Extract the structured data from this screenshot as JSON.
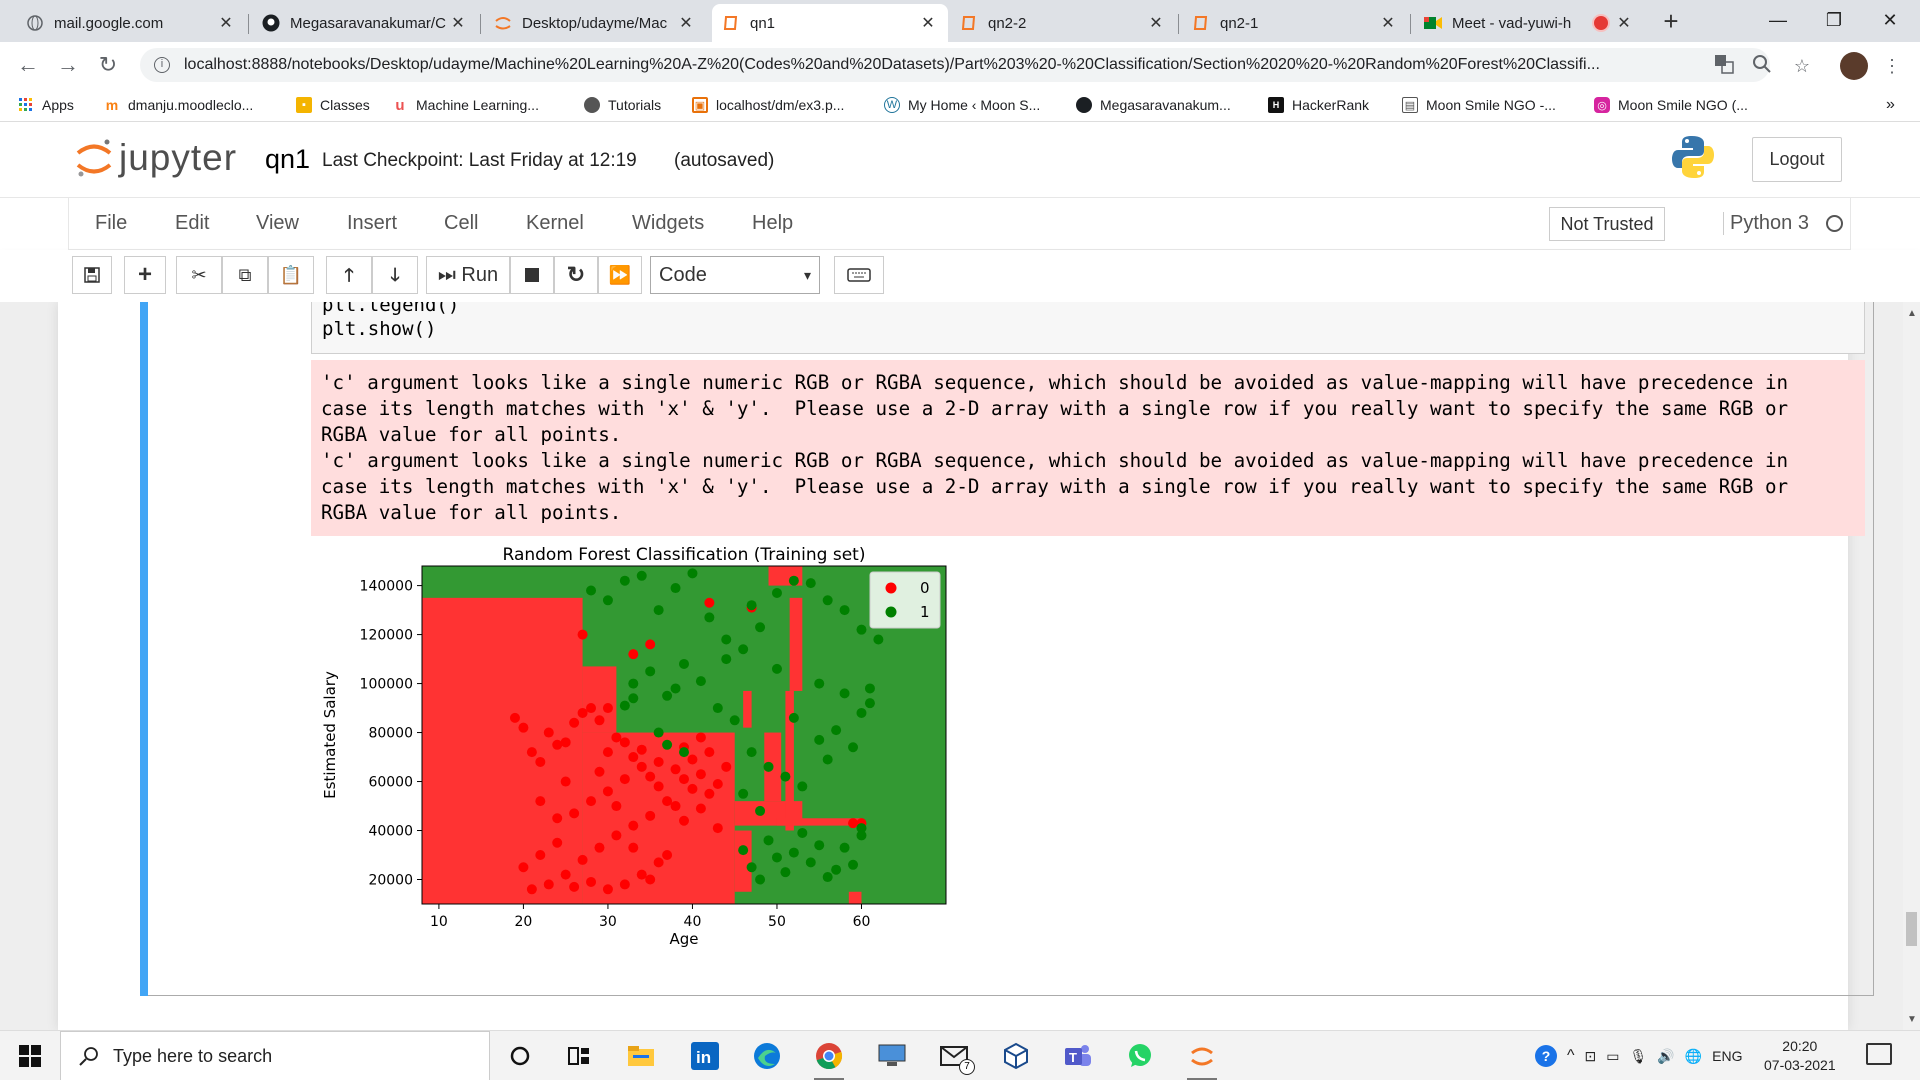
{
  "browser": {
    "tabs": [
      {
        "title": "mail.google.com",
        "icon": "globe-icon"
      },
      {
        "title": "Megasaravanakumar/C",
        "icon": "github-icon"
      },
      {
        "title": "Desktop/udayme/Mac",
        "icon": "jupyter-icon"
      },
      {
        "title": "qn1",
        "icon": "notebook-icon",
        "active": true
      },
      {
        "title": "qn2-2",
        "icon": "notebook-icon"
      },
      {
        "title": "qn2-1",
        "icon": "notebook-icon"
      },
      {
        "title": "Meet - vad-yuwi-h",
        "icon": "meet-icon",
        "recording": true
      }
    ],
    "new_tab": "+",
    "url": "localhost:8888/notebooks/Desktop/udayme/Machine%20Learning%20A-Z%20(Codes%20and%20Datasets)/Part%203%20-%20Classification/Section%2020%20-%20Random%20Forest%20Classifi...",
    "bookmarks": [
      {
        "label": "Apps",
        "icon": "apps-grid-icon"
      },
      {
        "label": "dmanju.moodleclo...",
        "icon": "moodle-icon"
      },
      {
        "label": "Classes",
        "icon": "classroom-icon"
      },
      {
        "label": "Machine Learning...",
        "icon": "udemy-icon"
      },
      {
        "label": "Tutorials",
        "icon": "tutorials-icon"
      },
      {
        "label": "localhost/dm/ex3.p...",
        "icon": "localhost-icon"
      },
      {
        "label": "My Home ‹ Moon S...",
        "icon": "wordpress-icon"
      },
      {
        "label": "Megasaravanakum...",
        "icon": "github-icon"
      },
      {
        "label": "HackerRank",
        "icon": "hackerrank-icon"
      },
      {
        "label": "Moon Smile NGO -...",
        "icon": "page-icon"
      },
      {
        "label": "Moon Smile NGO (...",
        "icon": "instagram-icon"
      }
    ],
    "more_bookmarks": "»"
  },
  "jupyter": {
    "logo_text": "jupyter",
    "notebook_name": "qn1",
    "checkpoint": "Last Checkpoint: Last Friday at 12:19",
    "autosave": "(autosaved)",
    "logout": "Logout",
    "menus": [
      "File",
      "Edit",
      "View",
      "Insert",
      "Cell",
      "Kernel",
      "Widgets",
      "Help"
    ],
    "trust": "Not Trusted",
    "kernel": "Python 3",
    "run_label": "Run",
    "cell_type": "Code"
  },
  "cell": {
    "code_lines": [
      "plt.legend()",
      "plt.show()"
    ],
    "stderr_lines": [
      "'c' argument looks like a single numeric RGB or RGBA sequence, which should be avoided as value-mapping will have precedence in",
      "case its length matches with 'x' & 'y'.  Please use a 2-D array with a single row if you really want to specify the same RGB or",
      "RGBA value for all points.",
      "'c' argument looks like a single numeric RGB or RGBA sequence, which should be avoided as value-mapping will have precedence in",
      "case its length matches with 'x' & 'y'.  Please use a 2-D array with a single row if you really want to specify the same RGB or",
      "RGBA value for all points."
    ]
  },
  "chart_data": {
    "type": "scatter",
    "title": "Random Forest Classification (Training set)",
    "xlabel": "Age",
    "ylabel": "Estimated Salary",
    "xlim": [
      8,
      70
    ],
    "ylim": [
      10000,
      148000
    ],
    "xticks": [
      10,
      20,
      30,
      40,
      50,
      60
    ],
    "yticks": [
      20000,
      40000,
      60000,
      80000,
      100000,
      120000,
      140000
    ],
    "legend_position": "top-right",
    "colors": {
      "0": "#ff0000",
      "1": "#008000",
      "region_0": "#ff3333",
      "region_1": "#339933"
    },
    "regions": [
      {
        "class": "0",
        "x": [
          8,
          27
        ],
        "y": [
          10000,
          135000
        ]
      },
      {
        "class": "0",
        "x": [
          27,
          45
        ],
        "y": [
          10000,
          80000
        ]
      },
      {
        "class": "0",
        "x": [
          27,
          31
        ],
        "y": [
          80000,
          107000
        ]
      },
      {
        "class": "0",
        "x": [
          45,
          53
        ],
        "y": [
          42000,
          52000
        ]
      },
      {
        "class": "0",
        "x": [
          45,
          47
        ],
        "y": [
          15000,
          40000
        ]
      },
      {
        "class": "0",
        "x": [
          46,
          47
        ],
        "y": [
          82000,
          97000
        ]
      },
      {
        "class": "0",
        "x": [
          48.5,
          50.5
        ],
        "y": [
          52000,
          80000
        ]
      },
      {
        "class": "0",
        "x": [
          49,
          53
        ],
        "y": [
          140000,
          148000
        ]
      },
      {
        "class": "0",
        "x": [
          51.5,
          53
        ],
        "y": [
          97000,
          135000
        ]
      },
      {
        "class": "0",
        "x": [
          51,
          52
        ],
        "y": [
          40000,
          97000
        ]
      },
      {
        "class": "0",
        "x": [
          50,
          60
        ],
        "y": [
          42000,
          45000
        ]
      },
      {
        "class": "0",
        "x": [
          58.5,
          60
        ],
        "y": [
          10000,
          15000
        ]
      }
    ],
    "series": [
      {
        "name": "0",
        "points": [
          [
            19,
            86000
          ],
          [
            20,
            82000
          ],
          [
            21,
            72000
          ],
          [
            22,
            68000
          ],
          [
            23,
            80000
          ],
          [
            24,
            75000
          ],
          [
            25,
            60000
          ],
          [
            26,
            84000
          ],
          [
            27,
            88000
          ],
          [
            28,
            90000
          ],
          [
            29,
            85000
          ],
          [
            30,
            72000
          ],
          [
            31,
            78000
          ],
          [
            32,
            76000
          ],
          [
            33,
            70000
          ],
          [
            34,
            66000
          ],
          [
            35,
            62000
          ],
          [
            36,
            58000
          ],
          [
            37,
            52000
          ],
          [
            38,
            50000
          ],
          [
            39,
            61000
          ],
          [
            40,
            57000
          ],
          [
            41,
            63000
          ],
          [
            42,
            55000
          ],
          [
            43,
            59000
          ],
          [
            35,
            46000
          ],
          [
            33,
            42000
          ],
          [
            31,
            38000
          ],
          [
            29,
            33000
          ],
          [
            27,
            28000
          ],
          [
            25,
            22000
          ],
          [
            23,
            18000
          ],
          [
            21,
            16000
          ],
          [
            24,
            35000
          ],
          [
            26,
            47000
          ],
          [
            28,
            52000
          ],
          [
            30,
            56000
          ],
          [
            32,
            61000
          ],
          [
            34,
            73000
          ],
          [
            36,
            68000
          ],
          [
            38,
            65000
          ],
          [
            40,
            69000
          ],
          [
            42,
            72000
          ],
          [
            44,
            66000
          ],
          [
            37,
            30000
          ],
          [
            39,
            44000
          ],
          [
            41,
            49000
          ],
          [
            43,
            41000
          ],
          [
            26,
            17000
          ],
          [
            28,
            19000
          ],
          [
            30,
            16000
          ],
          [
            32,
            18000
          ],
          [
            34,
            22000
          ],
          [
            36,
            27000
          ],
          [
            20,
            25000
          ],
          [
            22,
            30000
          ],
          [
            35,
            116000
          ],
          [
            42,
            133000
          ],
          [
            47,
            131000
          ],
          [
            59,
            43000
          ],
          [
            60,
            43000
          ],
          [
            30,
            90000
          ],
          [
            27,
            120000
          ],
          [
            33,
            112000
          ],
          [
            25,
            76000
          ],
          [
            29,
            64000
          ],
          [
            31,
            50000
          ],
          [
            33,
            33000
          ],
          [
            35,
            20000
          ],
          [
            39,
            74000
          ],
          [
            41,
            78000
          ],
          [
            22,
            52000
          ],
          [
            24,
            45000
          ]
        ]
      },
      {
        "name": "1",
        "points": [
          [
            28,
            138000
          ],
          [
            30,
            134000
          ],
          [
            32,
            142000
          ],
          [
            34,
            144000
          ],
          [
            36,
            130000
          ],
          [
            38,
            139000
          ],
          [
            40,
            145000
          ],
          [
            42,
            127000
          ],
          [
            44,
            118000
          ],
          [
            46,
            114000
          ],
          [
            48,
            123000
          ],
          [
            50,
            137000
          ],
          [
            52,
            142000
          ],
          [
            54,
            141000
          ],
          [
            56,
            134000
          ],
          [
            58,
            130000
          ],
          [
            60,
            122000
          ],
          [
            62,
            118000
          ],
          [
            33,
            100000
          ],
          [
            35,
            105000
          ],
          [
            37,
            95000
          ],
          [
            39,
            108000
          ],
          [
            41,
            101000
          ],
          [
            43,
            90000
          ],
          [
            45,
            85000
          ],
          [
            47,
            72000
          ],
          [
            49,
            66000
          ],
          [
            51,
            62000
          ],
          [
            53,
            58000
          ],
          [
            55,
            77000
          ],
          [
            57,
            81000
          ],
          [
            59,
            74000
          ],
          [
            61,
            92000
          ],
          [
            46,
            32000
          ],
          [
            47,
            25000
          ],
          [
            48,
            20000
          ],
          [
            49,
            36000
          ],
          [
            50,
            29000
          ],
          [
            51,
            23000
          ],
          [
            52,
            31000
          ],
          [
            53,
            39000
          ],
          [
            54,
            27000
          ],
          [
            55,
            34000
          ],
          [
            56,
            21000
          ],
          [
            57,
            24000
          ],
          [
            58,
            33000
          ],
          [
            59,
            26000
          ],
          [
            60,
            38000
          ],
          [
            60,
            41000
          ],
          [
            37,
            75000
          ],
          [
            39,
            72000
          ],
          [
            36,
            80000
          ],
          [
            32,
            91000
          ],
          [
            33,
            94000
          ],
          [
            38,
            98000
          ],
          [
            55,
            100000
          ],
          [
            58,
            96000
          ],
          [
            60,
            88000
          ],
          [
            61,
            98000
          ],
          [
            44,
            110000
          ],
          [
            47,
            132000
          ],
          [
            50,
            106000
          ],
          [
            52,
            86000
          ],
          [
            56,
            69000
          ],
          [
            46,
            55000
          ],
          [
            48,
            48000
          ]
        ]
      }
    ]
  },
  "taskbar": {
    "search_placeholder": "Type here to search",
    "apps": [
      "cortana-icon",
      "task-view-icon",
      "file-explorer-icon",
      "linkedin-icon",
      "edge-icon",
      "chrome-icon",
      "remote-desktop-icon",
      "mail-icon",
      "3d-viewer-icon",
      "teams-icon",
      "whatsapp-icon",
      "jupyter-icon"
    ],
    "mail_badge": "7",
    "language": "ENG",
    "time": "20:20",
    "date": "07-03-2021"
  }
}
